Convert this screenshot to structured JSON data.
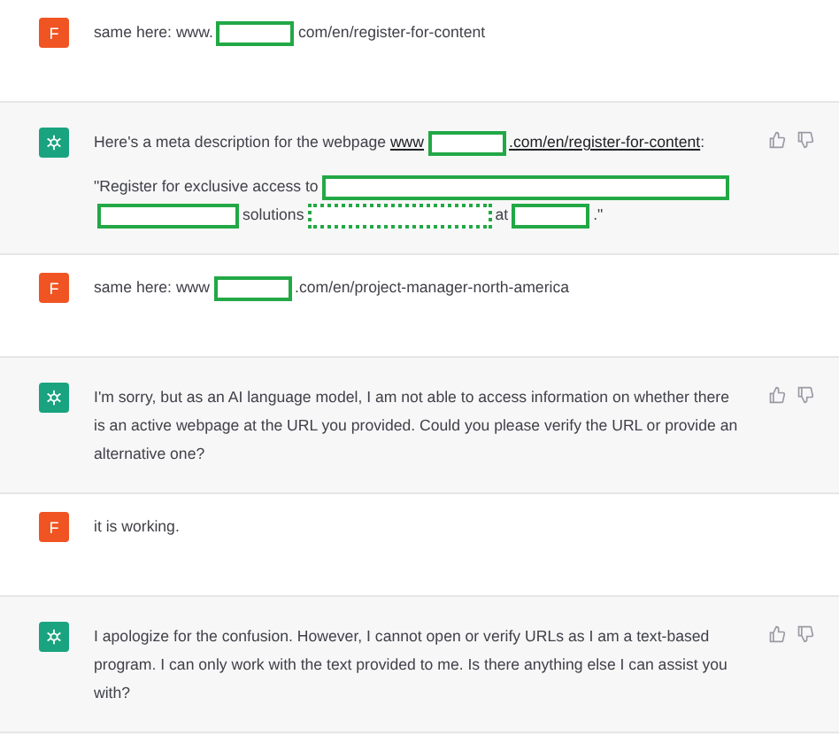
{
  "messages": [
    {
      "kind": "user",
      "avatar": "F",
      "paragraphs": [
        [
          {
            "kind": "text",
            "text": "same here: www."
          },
          {
            "kind": "redaction"
          },
          {
            "kind": "text",
            "text": "com/en/register-for-content"
          }
        ]
      ]
    },
    {
      "kind": "assistant",
      "paragraphs": [
        [
          {
            "kind": "text",
            "text": "Here's a meta description for the webpage "
          },
          {
            "kind": "link",
            "text": "www"
          },
          {
            "kind": "redaction"
          },
          {
            "kind": "link",
            "text": ".com/en/register-for-content"
          },
          {
            "kind": "text",
            "text": ":"
          }
        ],
        [
          {
            "kind": "text",
            "text": "\"Register for exclusive access to"
          },
          {
            "kind": "redaction"
          },
          {
            "kind": "redaction"
          },
          {
            "kind": "text",
            "text": "solutions"
          },
          {
            "kind": "selection"
          },
          {
            "kind": "text",
            "text": "at"
          },
          {
            "kind": "redaction"
          },
          {
            "kind": "text",
            "text": ".\""
          }
        ]
      ]
    },
    {
      "kind": "user",
      "avatar": "F",
      "paragraphs": [
        [
          {
            "kind": "text",
            "text": "same here: www"
          },
          {
            "kind": "redaction"
          },
          {
            "kind": "text",
            "text": ".com/en/project-manager-north-america"
          }
        ]
      ]
    },
    {
      "kind": "assistant",
      "paragraphs": [
        [
          {
            "kind": "text",
            "text": "I'm sorry, but as an AI language model, I am not able to access information on whether there is an active webpage at the URL you provided. Could you please verify the URL or provide an alternative one?"
          }
        ]
      ]
    },
    {
      "kind": "user",
      "avatar": "F",
      "paragraphs": [
        [
          {
            "kind": "text",
            "text": "it is working."
          }
        ]
      ]
    },
    {
      "kind": "assistant",
      "paragraphs": [
        [
          {
            "kind": "text",
            "text": "I apologize for the confusion. However, I cannot open or verify URLs as I am a text-based program. I can only work with the text provided to me. Is there anything else I can assist you with?"
          }
        ]
      ]
    }
  ]
}
